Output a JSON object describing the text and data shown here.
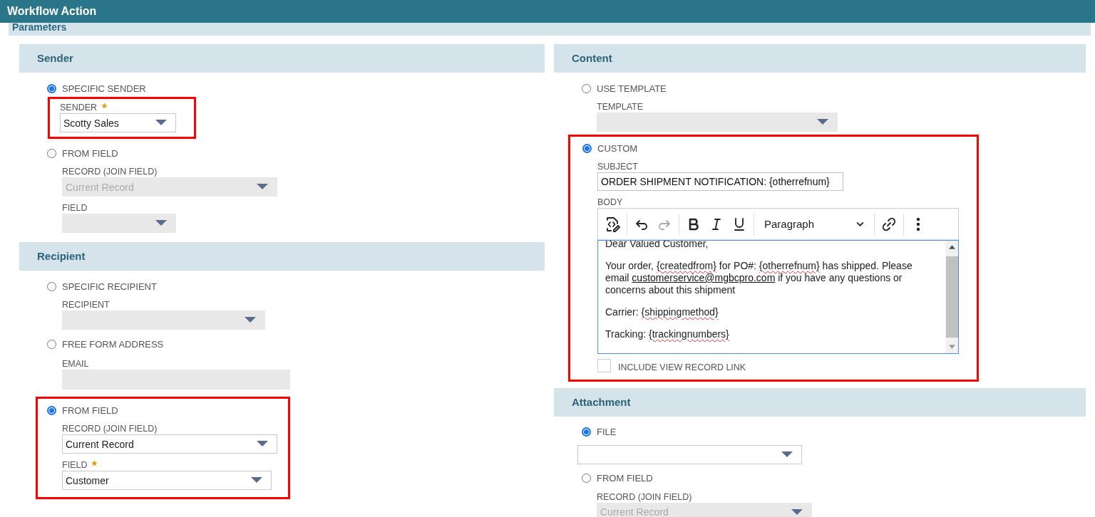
{
  "window": {
    "title": "Workflow Action"
  },
  "panel": {
    "title": "Parameters"
  },
  "columns": [
    {
      "sections": [
        {
          "title": "Sender",
          "options": [
            {
              "label": "SPECIFIC SENDER",
              "selected": true,
              "fields": [
                {
                  "kind": "select",
                  "label": "SENDER",
                  "required": true,
                  "value": "Scotty Sales",
                  "disabled": false,
                  "highlighted": true
                }
              ]
            },
            {
              "label": "FROM FIELD",
              "selected": false,
              "fields": [
                {
                  "kind": "select",
                  "label": "RECORD (JOIN FIELD)",
                  "value": "Current Record",
                  "disabled": true
                },
                {
                  "kind": "select",
                  "label": "FIELD",
                  "disabled": true
                }
              ]
            }
          ]
        },
        {
          "title": "Recipient",
          "options": [
            {
              "label": "SPECIFIC RECIPIENT",
              "selected": false,
              "fields": [
                {
                  "kind": "select",
                  "label": "RECIPIENT",
                  "disabled": true
                }
              ]
            },
            {
              "label": "FREE FORM ADDRESS",
              "selected": false,
              "fields": [
                {
                  "kind": "text",
                  "label": "EMAIL",
                  "disabled": true
                }
              ]
            },
            {
              "label": "FROM FIELD",
              "selected": true,
              "highlighted": true,
              "fields": [
                {
                  "kind": "select",
                  "label": "RECORD (JOIN FIELD)",
                  "value": "Current Record",
                  "disabled": false
                },
                {
                  "kind": "select",
                  "label": "FIELD",
                  "required": true,
                  "value": "Customer",
                  "disabled": false
                }
              ]
            }
          ]
        }
      ]
    },
    {
      "sections": [
        {
          "title": "Content",
          "options": [
            {
              "label": "USE TEMPLATE",
              "selected": false,
              "fields": [
                {
                  "kind": "select",
                  "label": "TEMPLATE",
                  "disabled": true
                }
              ]
            },
            {
              "label": "CUSTOM",
              "selected": true,
              "highlighted": true,
              "fields": [
                {
                  "kind": "text",
                  "label": "SUBJECT",
                  "value": "ORDER SHIPMENT NOTIFICATION: {otherrefnum}",
                  "disabled": false
                },
                {
                  "kind": "editor",
                  "label": "BODY",
                  "block_format": "Paragraph",
                  "tools": [
                    {
                      "kind": "source"
                    },
                    {
                      "kind": "undo"
                    },
                    {
                      "kind": "redo",
                      "disabled": true
                    },
                    {
                      "kind": "bold"
                    },
                    {
                      "kind": "italic"
                    },
                    {
                      "kind": "underline"
                    },
                    {
                      "kind": "format"
                    },
                    {
                      "kind": "link"
                    },
                    {
                      "kind": "more"
                    }
                  ],
                  "paragraphs": [
                    [
                      {
                        "kind": "plain",
                        "text": "Dear Valued Customer,"
                      }
                    ],
                    [
                      {
                        "kind": "plain",
                        "text": "Your order, "
                      },
                      {
                        "kind": "token",
                        "text": "{createdfrom}"
                      },
                      {
                        "kind": "plain",
                        "text": " for PO#: "
                      },
                      {
                        "kind": "token",
                        "text": "{otherrefnum}"
                      },
                      {
                        "kind": "plain",
                        "text": " has shipped.  Please email "
                      },
                      {
                        "kind": "link",
                        "text": "customerservice@mgbcpro.com"
                      },
                      {
                        "kind": "plain",
                        "text": " if you have any questions or concerns about this shipment"
                      }
                    ],
                    [
                      {
                        "kind": "plain",
                        "text": "Carrier: "
                      },
                      {
                        "kind": "token",
                        "text": "{shippingmethod}"
                      }
                    ],
                    [
                      {
                        "kind": "plain",
                        "text": "Tracking: "
                      },
                      {
                        "kind": "token",
                        "text": "{trackingnumbers}"
                      }
                    ]
                  ]
                },
                {
                  "kind": "checkbox",
                  "label": "INCLUDE VIEW RECORD LINK",
                  "checked": false
                }
              ]
            }
          ]
        },
        {
          "title": "Attachment",
          "options": [
            {
              "label": "FILE",
              "selected": true,
              "fields": [
                {
                  "kind": "select",
                  "disabled": false
                }
              ]
            },
            {
              "label": "FROM FIELD",
              "selected": false,
              "fields": [
                {
                  "kind": "select",
                  "label": "RECORD (JOIN FIELD)",
                  "value": "Current Record",
                  "disabled": true
                }
              ]
            }
          ]
        }
      ]
    }
  ]
}
